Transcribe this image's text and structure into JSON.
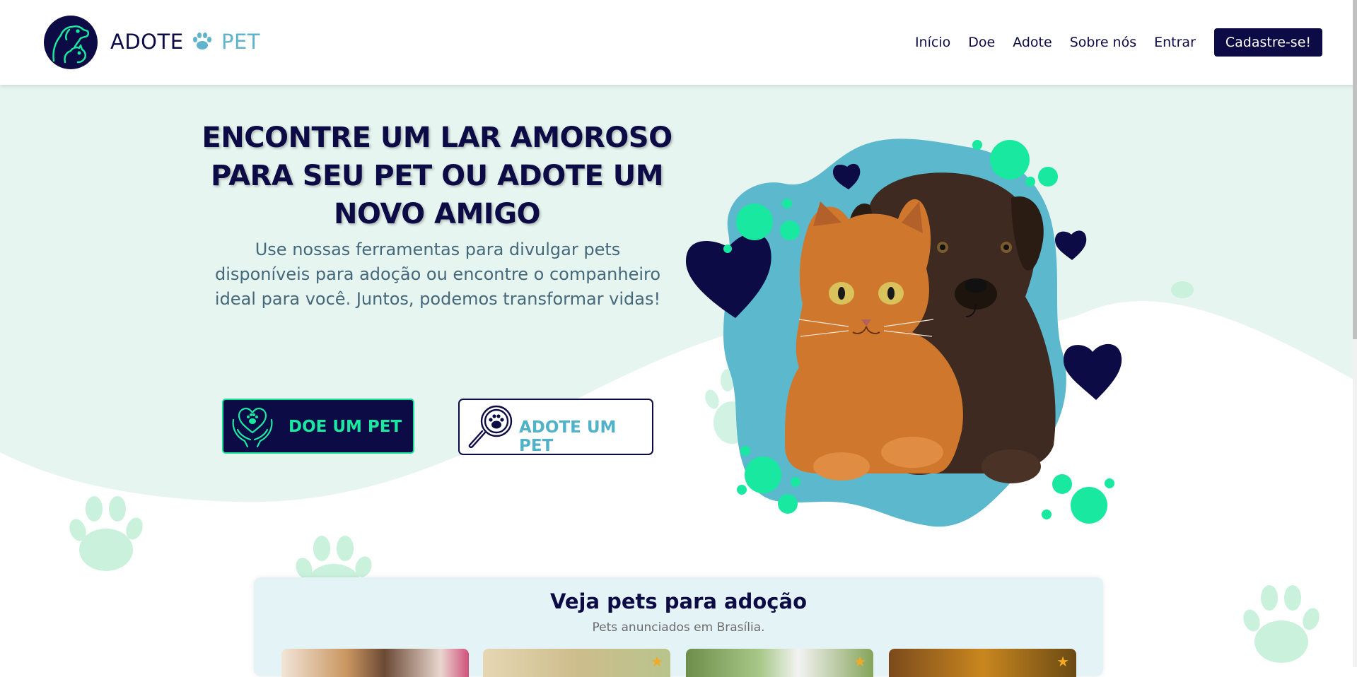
{
  "header": {
    "logo": {
      "word1": "ADOTE",
      "paw_icon": "paw-icon",
      "word2": "PET"
    },
    "nav": [
      {
        "label": "Início"
      },
      {
        "label": "Doe"
      },
      {
        "label": "Adote"
      },
      {
        "label": "Sobre nós"
      },
      {
        "label": "Entrar"
      }
    ],
    "cta_label": "Cadastre-se!"
  },
  "hero": {
    "title": "ENCONTRE UM LAR AMOROSO PARA SEU PET OU ADOTE UM NOVO AMIGO",
    "subtitle": "Use nossas ferramentas para divulgar pets disponíveis para adoção ou encontre o companheiro ideal para você. Juntos, podemos transformar vidas!",
    "donate_button": {
      "label": "DOE UM PET",
      "icon": "heart-hands-paw-icon"
    },
    "adopt_button": {
      "label": "ADOTE UM PET",
      "icon": "magnifier-paw-icon"
    }
  },
  "pets_section": {
    "title": "Veja pets para adoção",
    "subtitle": "Pets anunciados em Brasília."
  },
  "colors": {
    "navy": "#0d0b45",
    "mint": "#19e8a0",
    "teal": "#5fb3cc",
    "hero_bg": "#e6f5f0"
  }
}
